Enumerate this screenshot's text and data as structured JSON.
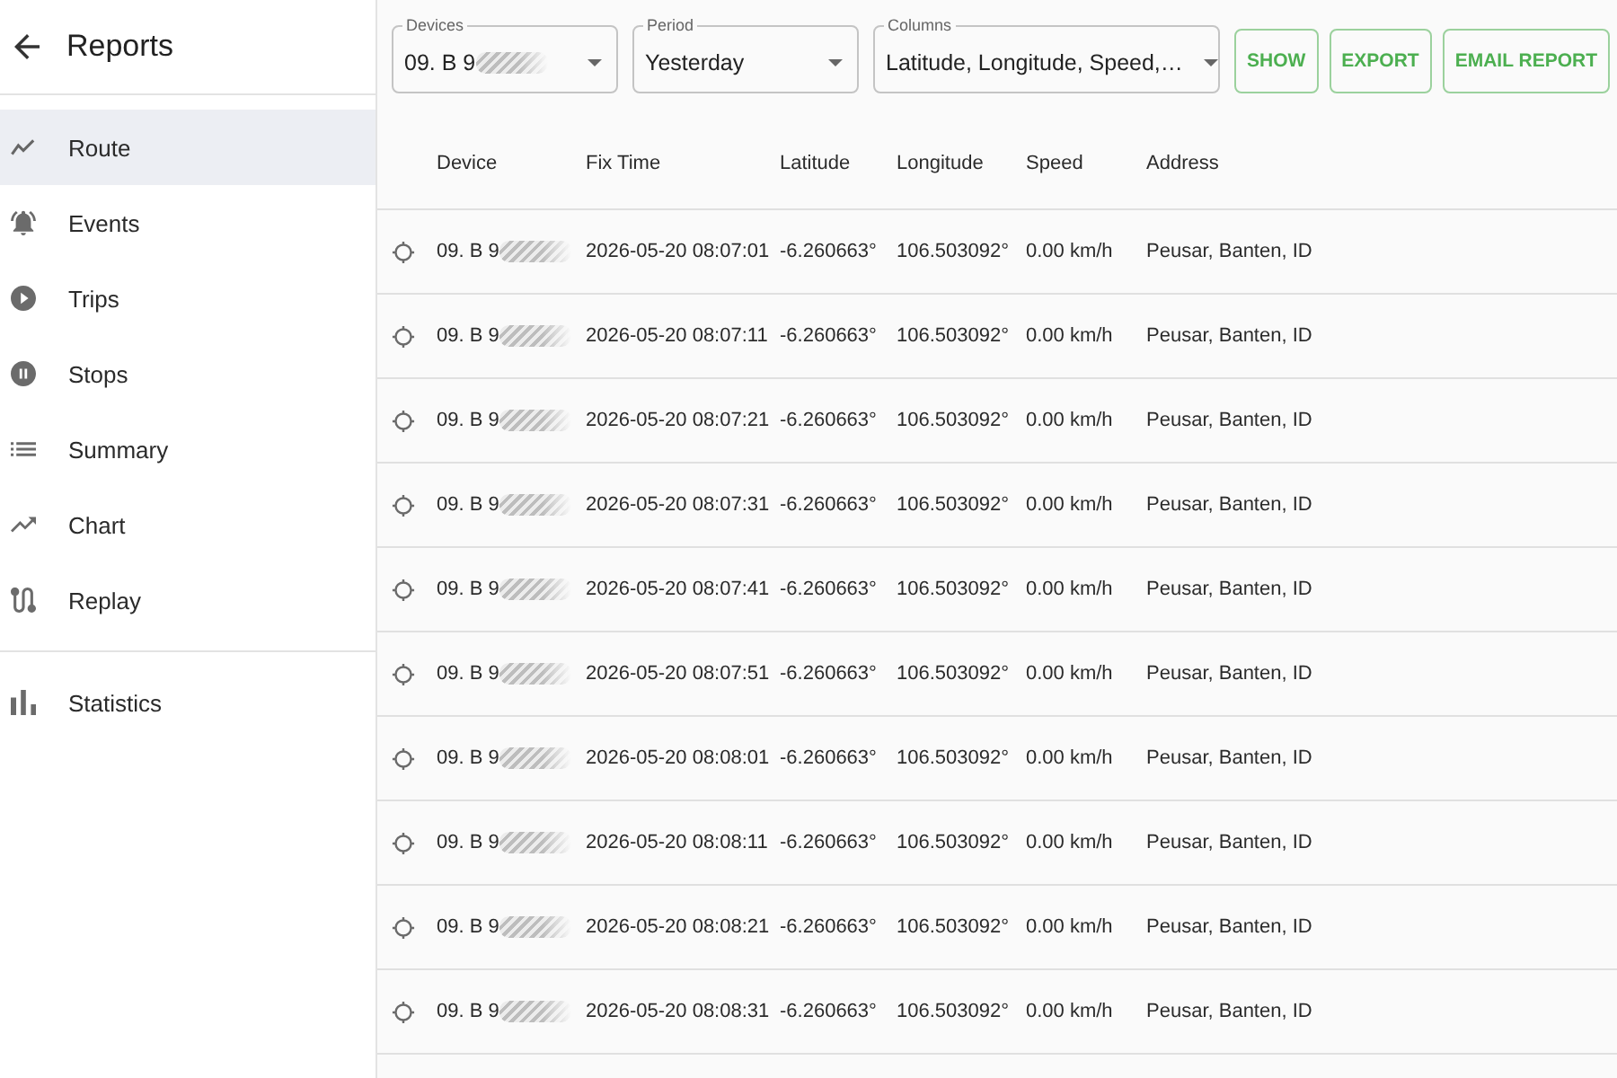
{
  "header": {
    "title": "Reports"
  },
  "sidebar": {
    "groups": [
      {
        "items": [
          {
            "label": "Route",
            "selected": true
          },
          {
            "label": "Events",
            "selected": false
          },
          {
            "label": "Trips",
            "selected": false
          },
          {
            "label": "Stops",
            "selected": false
          },
          {
            "label": "Summary",
            "selected": false
          },
          {
            "label": "Chart",
            "selected": false
          },
          {
            "label": "Replay",
            "selected": false
          }
        ]
      },
      {
        "items": [
          {
            "label": "Statistics",
            "selected": false
          }
        ]
      }
    ]
  },
  "toolbar": {
    "fields": [
      {
        "label": "Devices",
        "value": "09. B 9",
        "redacted": true
      },
      {
        "label": "Period",
        "value": "Yesterday",
        "redacted": false
      },
      {
        "label": "Columns",
        "value": "Latitude, Longitude, Speed,…",
        "redacted": false
      }
    ],
    "buttons": [
      "SHOW",
      "EXPORT",
      "EMAIL REPORT"
    ]
  },
  "table": {
    "columns": [
      "Device",
      "Fix Time",
      "Latitude",
      "Longitude",
      "Speed",
      "Address"
    ],
    "rows": [
      {
        "device": "09. B 9",
        "redacted": true,
        "fix_time": "2026-05-20 08:07:01",
        "latitude": "-6.260663°",
        "longitude": "106.503092°",
        "speed": "0.00 km/h",
        "address": "Peusar, Banten, ID"
      },
      {
        "device": "09. B 9",
        "redacted": true,
        "fix_time": "2026-05-20 08:07:11",
        "latitude": "-6.260663°",
        "longitude": "106.503092°",
        "speed": "0.00 km/h",
        "address": "Peusar, Banten, ID"
      },
      {
        "device": "09. B 9",
        "redacted": true,
        "fix_time": "2026-05-20 08:07:21",
        "latitude": "-6.260663°",
        "longitude": "106.503092°",
        "speed": "0.00 km/h",
        "address": "Peusar, Banten, ID"
      },
      {
        "device": "09. B 9",
        "redacted": true,
        "fix_time": "2026-05-20 08:07:31",
        "latitude": "-6.260663°",
        "longitude": "106.503092°",
        "speed": "0.00 km/h",
        "address": "Peusar, Banten, ID"
      },
      {
        "device": "09. B 9",
        "redacted": true,
        "fix_time": "2026-05-20 08:07:41",
        "latitude": "-6.260663°",
        "longitude": "106.503092°",
        "speed": "0.00 km/h",
        "address": "Peusar, Banten, ID"
      },
      {
        "device": "09. B 9",
        "redacted": true,
        "fix_time": "2026-05-20 08:07:51",
        "latitude": "-6.260663°",
        "longitude": "106.503092°",
        "speed": "0.00 km/h",
        "address": "Peusar, Banten, ID"
      },
      {
        "device": "09. B 9",
        "redacted": true,
        "fix_time": "2026-05-20 08:08:01",
        "latitude": "-6.260663°",
        "longitude": "106.503092°",
        "speed": "0.00 km/h",
        "address": "Peusar, Banten, ID"
      },
      {
        "device": "09. B 9",
        "redacted": true,
        "fix_time": "2026-05-20 08:08:11",
        "latitude": "-6.260663°",
        "longitude": "106.503092°",
        "speed": "0.00 km/h",
        "address": "Peusar, Banten, ID"
      },
      {
        "device": "09. B 9",
        "redacted": true,
        "fix_time": "2026-05-20 08:08:21",
        "latitude": "-6.260663°",
        "longitude": "106.503092°",
        "speed": "0.00 km/h",
        "address": "Peusar, Banten, ID"
      },
      {
        "device": "09. B 9",
        "redacted": true,
        "fix_time": "2026-05-20 08:08:31",
        "latitude": "-6.260663°",
        "longitude": "106.503092°",
        "speed": "0.00 km/h",
        "address": "Peusar, Banten, ID"
      }
    ]
  }
}
